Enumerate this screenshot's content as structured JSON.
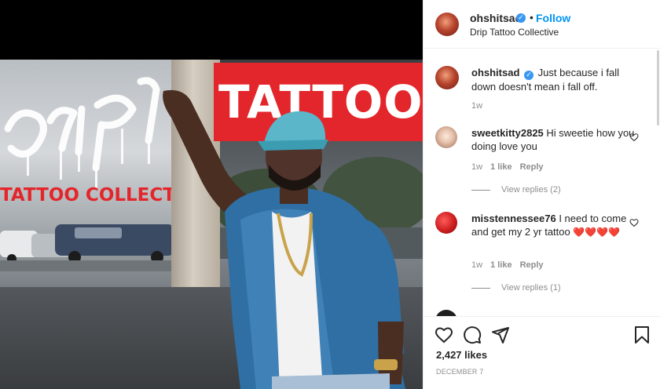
{
  "post": {
    "owner": "ohshitsad",
    "location": "Drip Tattoo Collective",
    "follow_label": "Follow",
    "dot": "•",
    "sign_text": "TATTOO",
    "collective_text": "TATTOO COLLECTIVE",
    "caption": {
      "username": "ohshitsad",
      "text": "Just because i fall down doesn't mean i fall off.",
      "time": "1w"
    },
    "likes": "2,427 likes",
    "date": "DECEMBER 7"
  },
  "comments": [
    {
      "username": "sweetkitty2825",
      "text": "Hi sweetie how you doing love you",
      "time": "1w",
      "likes": "1 like",
      "reply_label": "Reply",
      "view_replies": "View replies (2)"
    },
    {
      "username": "misstennessee76",
      "text": "I need to come and get my 2 yr tattoo",
      "emoji": "❤️❤️❤️❤️",
      "time": "1w",
      "likes": "1 like",
      "reply_label": "Reply",
      "view_replies": "View replies (1)"
    }
  ],
  "icons": {
    "like": "heart-icon",
    "comment": "comment-icon",
    "share": "share-icon",
    "save": "bookmark-icon",
    "verified": "verified-badge-icon"
  },
  "colors": {
    "link_blue": "#0095f6",
    "verified_blue": "#3897f0",
    "heart_red": "#ed4956",
    "meta_gray": "#8e8e8e",
    "sign_red": "#e3262b"
  }
}
